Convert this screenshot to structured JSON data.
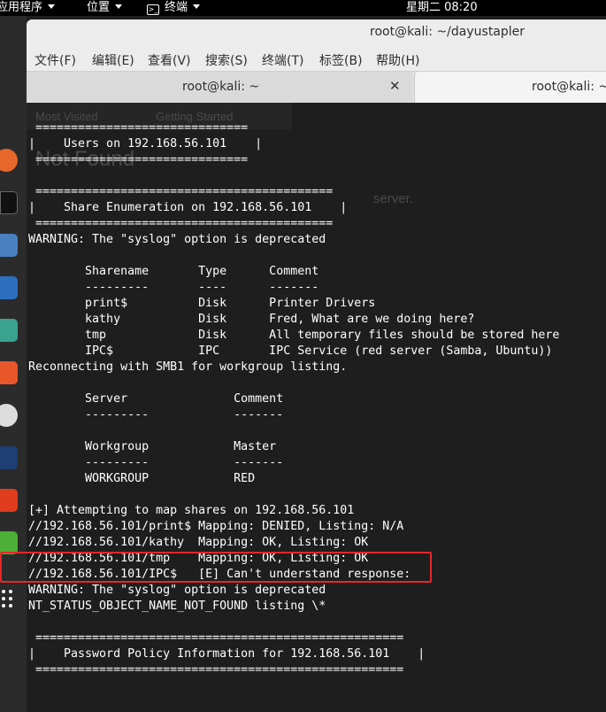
{
  "top_panel": {
    "applications": "应用程序",
    "places": "位置",
    "terminal": "终端",
    "clock": "星期二 08:20"
  },
  "window": {
    "title": "root@kali: ~/dayustapler",
    "menu": [
      "文件(F)",
      "编辑(E)",
      "查看(V)",
      "搜索(S)",
      "终端(T)",
      "标签(B)",
      "帮助(H)"
    ],
    "tabs": [
      "root@kali: ~",
      "root@kali: ~/"
    ]
  },
  "background_ghost": {
    "bookmarks": "Most Visited",
    "getting_started": "Getting Started",
    "heading": "Not Found",
    "body_tail": "server."
  },
  "terminal_lines": [
    " ==============================",
    "|    Users on 192.168.56.101    |",
    " ==============================",
    "",
    " ==========================================",
    "|    Share Enumeration on 192.168.56.101    |",
    " ==========================================",
    "WARNING: The \"syslog\" option is deprecated",
    "",
    "        Sharename       Type      Comment",
    "        ---------       ----      -------",
    "        print$          Disk      Printer Drivers",
    "        kathy           Disk      Fred, What are we doing here?",
    "        tmp             Disk      All temporary files should be stored here",
    "        IPC$            IPC       IPC Service (red server (Samba, Ubuntu))",
    "Reconnecting with SMB1 for workgroup listing.",
    "",
    "        Server               Comment",
    "        ---------            -------",
    "",
    "        Workgroup            Master",
    "        ---------            -------",
    "        WORKGROUP            RED",
    "",
    "[+] Attempting to map shares on 192.168.56.101",
    "//192.168.56.101/print$ Mapping: DENIED, Listing: N/A",
    "//192.168.56.101/kathy  Mapping: OK, Listing: OK",
    "//192.168.56.101/tmp    Mapping: OK, Listing: OK",
    "//192.168.56.101/IPC$   [E] Can't understand response:",
    "WARNING: The \"syslog\" option is deprecated",
    "NT_STATUS_OBJECT_NAME_NOT_FOUND listing \\*",
    "",
    " ====================================================",
    "|    Password Policy Information for 192.168.56.101    |",
    " ===================================================="
  ],
  "colors": {
    "terminal_bg": "#1e1e1e",
    "terminal_fg": "#ffffff",
    "highlight": "#e8262a",
    "chrome": "#ececec"
  }
}
